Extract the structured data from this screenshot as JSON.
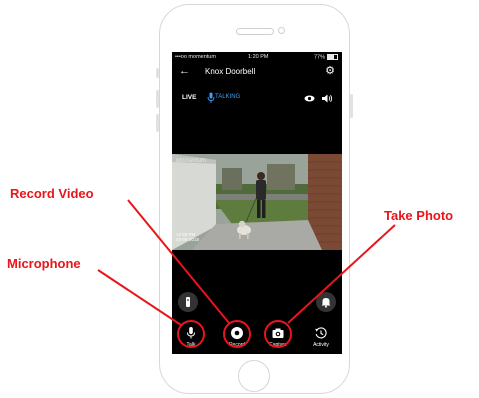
{
  "status_bar": {
    "carrier": "•••oo momentum",
    "time": "1:20 PM",
    "battery": "77%"
  },
  "app_bar": {
    "back_icon": "arrow-left-icon",
    "title": "Knox Doorbell",
    "settings_icon": "gear-icon"
  },
  "live_bar": {
    "live_label": "LIVE",
    "talking_label": "TALKING",
    "accent_color": "#3aa0ff"
  },
  "video": {
    "watermark": "Momentum",
    "timestamp_line1": "12:56 PM",
    "timestamp_line2": "04-04-2018"
  },
  "bottom_nav": [
    {
      "label": "Talk",
      "icon": "microphone-icon"
    },
    {
      "label": "Record",
      "icon": "record-icon"
    },
    {
      "label": "Capture",
      "icon": "camera-icon"
    },
    {
      "label": "Activity",
      "icon": "history-icon"
    }
  ],
  "annotations": {
    "record_video": "Record Video",
    "microphone": "Microphone",
    "take_photo": "Take Photo",
    "color": "#e8151b"
  }
}
